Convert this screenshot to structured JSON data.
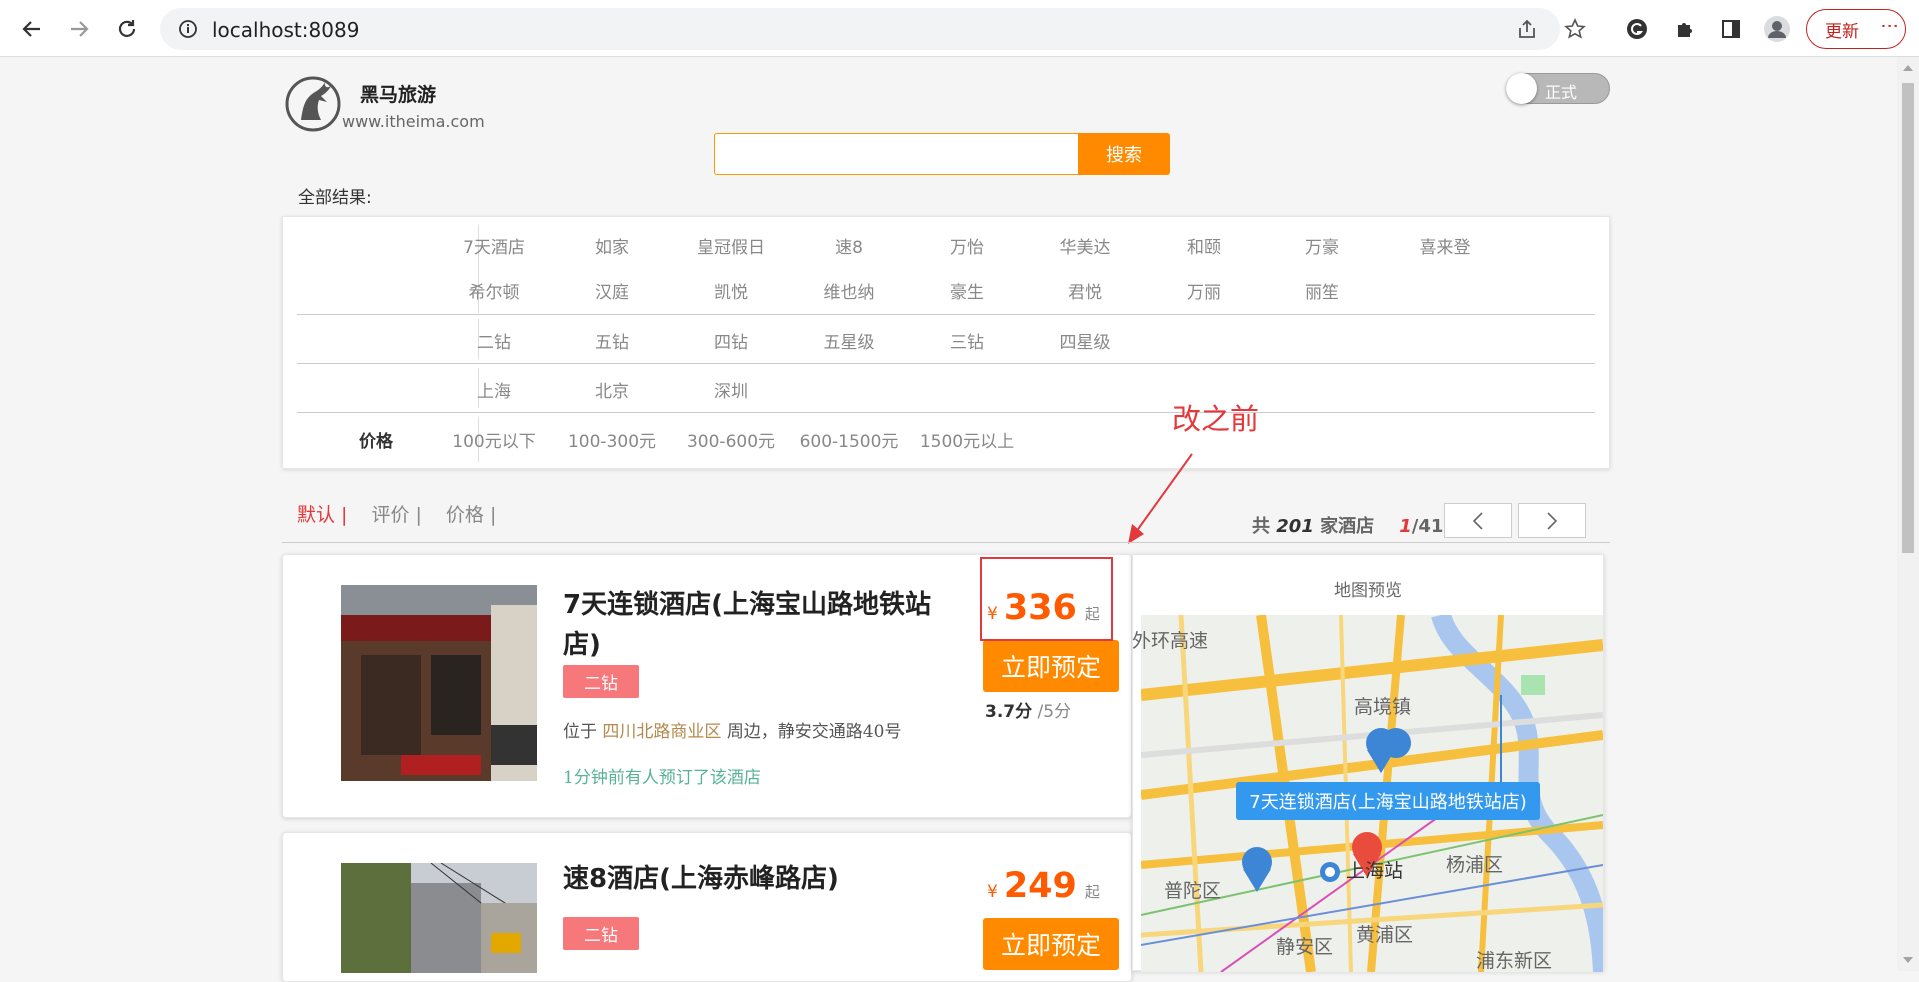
{
  "browser": {
    "url": "localhost:8089",
    "update_label": "更新"
  },
  "header": {
    "logo_title": "黑马旅游",
    "logo_subtitle": "www.itheima.com",
    "toggle_label": "正式",
    "search_placeholder": "",
    "search_button": "搜索"
  },
  "filters": {
    "all_results_label": "全部结果:",
    "brand_row1": [
      "7天酒店",
      "如家",
      "皇冠假日",
      "速8",
      "万怡",
      "华美达",
      "和颐",
      "万豪",
      "喜来登"
    ],
    "brand_row2": [
      "希尔顿",
      "汉庭",
      "凯悦",
      "维也纳",
      "豪生",
      "君悦",
      "万丽",
      "丽笙"
    ],
    "star_options": [
      "二钻",
      "五钻",
      "四钻",
      "五星级",
      "三钻",
      "四星级"
    ],
    "city_options": [
      "上海",
      "北京",
      "深圳"
    ],
    "price_key": "价格",
    "price_options": [
      "100元以下",
      "100-300元",
      "300-600元",
      "600-1500元",
      "1500元以上"
    ]
  },
  "sort": {
    "options": [
      "默认 |",
      "评价 |",
      "价格 |"
    ],
    "total_prefix": "共",
    "total_count": "201",
    "total_suffix": "家酒店",
    "page_current": "1",
    "page_total": "/41"
  },
  "annotation": {
    "text": "改之前"
  },
  "hotels": [
    {
      "name": "7天连锁酒店(上海宝山路地铁站店)",
      "badge": "二钻",
      "addr_prefix": "位于",
      "business_area": "四川北路商业区",
      "addr_suffix": "周边，静安交通路40号",
      "recent": "1分钟前有人预订了该酒店",
      "currency": "¥",
      "price": "336",
      "price_suffix": "起",
      "book_label": "立即预定",
      "score": "3.7分",
      "score_max": "/5分"
    },
    {
      "name": "速8酒店(上海赤峰路店)",
      "badge": "二钻",
      "currency": "¥",
      "price": "249",
      "price_suffix": "起",
      "book_label": "立即预定"
    }
  ],
  "map": {
    "title": "地图预览",
    "popup": "7天连锁酒店(上海宝山路地铁站店)",
    "labels": [
      "外环高速",
      "高境镇",
      "上海站",
      "杨浦区",
      "普陀区",
      "静安区",
      "黄浦区",
      "浦东新区"
    ]
  },
  "colors": {
    "accent": "#ff8a00",
    "price": "#ff5a00",
    "active_sort": "#e4393c",
    "badge": "#f7787a",
    "map_popup": "#3399ee"
  }
}
